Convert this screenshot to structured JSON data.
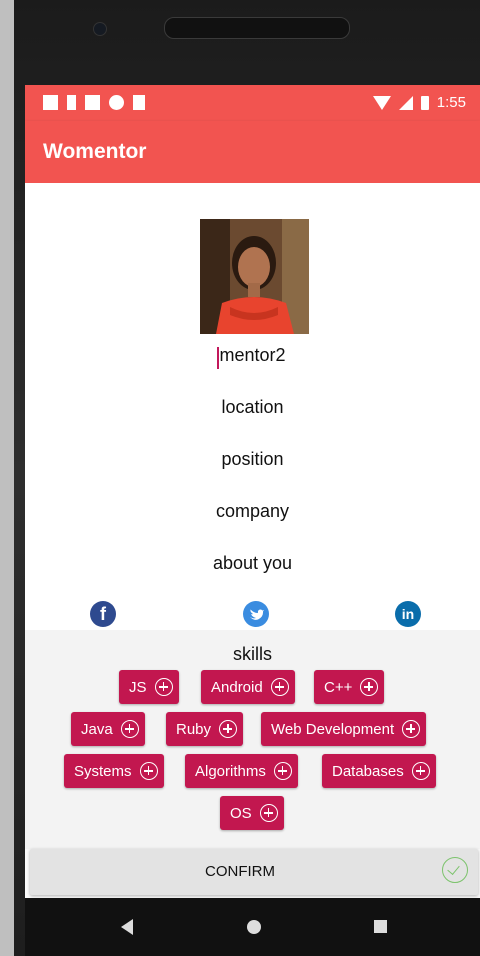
{
  "status_bar": {
    "time": "1:55"
  },
  "app_bar": {
    "title": "Womentor"
  },
  "profile": {
    "name": "mentor2",
    "location": "location",
    "position": "position",
    "company": "company",
    "about": "about you"
  },
  "social": {
    "facebook": "f",
    "linkedin": "in"
  },
  "skills": {
    "title": "skills",
    "items": [
      {
        "label": "JS"
      },
      {
        "label": "Android"
      },
      {
        "label": "C++"
      },
      {
        "label": "Java"
      },
      {
        "label": "Ruby"
      },
      {
        "label": "Web Development"
      },
      {
        "label": "Systems"
      },
      {
        "label": "Algorithms"
      },
      {
        "label": "Databases"
      },
      {
        "label": "OS"
      }
    ]
  },
  "actions": {
    "confirm_label": "CONFIRM"
  },
  "colors": {
    "accent": "#f25450",
    "chip": "#c2174f",
    "check": "#7cc36c"
  }
}
